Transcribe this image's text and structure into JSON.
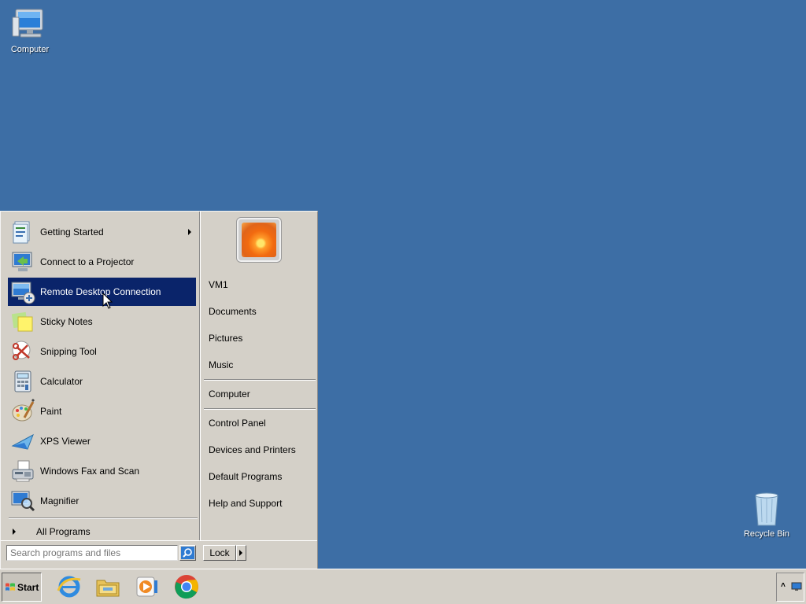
{
  "desktop": {
    "icons": [
      {
        "label": "Computer"
      },
      {
        "label": "Recycle Bin"
      }
    ]
  },
  "start_menu": {
    "programs": [
      {
        "label": "Getting Started",
        "icon": "getting-started-icon",
        "has_submenu": true
      },
      {
        "label": "Connect to a Projector",
        "icon": "projector-icon"
      },
      {
        "label": "Remote Desktop Connection",
        "icon": "remote-desktop-icon",
        "selected": true
      },
      {
        "label": "Sticky Notes",
        "icon": "sticky-notes-icon"
      },
      {
        "label": "Snipping Tool",
        "icon": "scissors-icon"
      },
      {
        "label": "Calculator",
        "icon": "calculator-icon"
      },
      {
        "label": "Paint",
        "icon": "paint-palette-icon"
      },
      {
        "label": "XPS Viewer",
        "icon": "xps-viewer-icon"
      },
      {
        "label": "Windows Fax and Scan",
        "icon": "fax-icon"
      },
      {
        "label": "Magnifier",
        "icon": "magnifier-icon"
      }
    ],
    "all_programs": "All Programs",
    "right": {
      "user": "VM1",
      "group1": [
        "Documents",
        "Pictures",
        "Music"
      ],
      "group2": [
        "Computer"
      ],
      "group3": [
        "Control Panel",
        "Devices and Printers",
        "Default Programs",
        "Help and Support"
      ]
    },
    "search_placeholder": "Search programs and files",
    "lock_label": "Lock"
  },
  "taskbar": {
    "start_label": "Start",
    "pinned": [
      "internet-explorer-icon",
      "file-explorer-icon",
      "media-player-icon",
      "chrome-icon"
    ]
  },
  "colors": {
    "desktop": "#3d6ea5",
    "selection": "#0a246a",
    "menu_bg": "#d4d0c8"
  }
}
